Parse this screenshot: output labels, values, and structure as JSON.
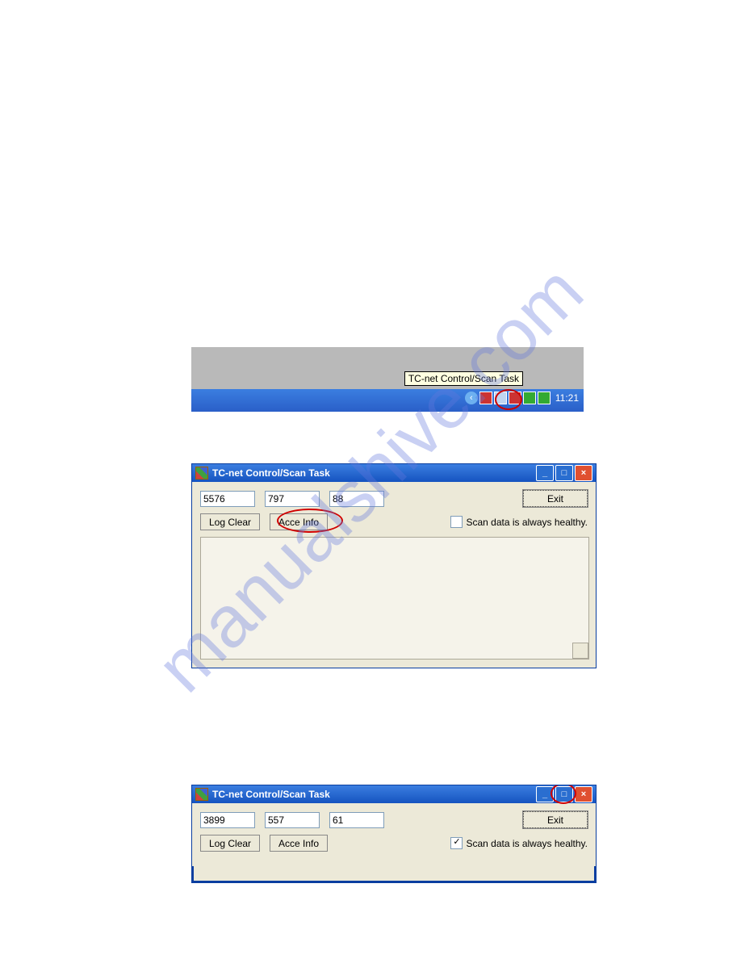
{
  "watermark": "manualshive.com",
  "taskbar": {
    "tooltip": "TC-net Control/Scan Task",
    "time": "11:21"
  },
  "window1": {
    "title": "TC-net Control/Scan Task",
    "field1": "5576",
    "field2": "797",
    "field3": "88",
    "exit": "Exit",
    "log_clear": "Log Clear",
    "acce_info": "Acce Info",
    "checkbox_label": "Scan data is always healthy.",
    "checked": false
  },
  "window2": {
    "title": "TC-net Control/Scan Task",
    "field1": "3899",
    "field2": "557",
    "field3": "61",
    "exit": "Exit",
    "log_clear": "Log Clear",
    "acce_info": "Acce Info",
    "checkbox_label": "Scan data is always healthy.",
    "checked": true
  }
}
